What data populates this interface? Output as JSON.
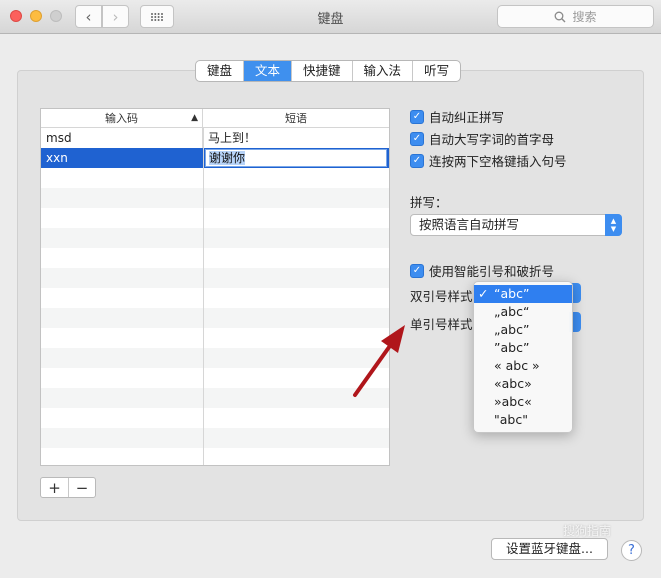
{
  "window": {
    "title": "键盘"
  },
  "search": {
    "placeholder": "搜索"
  },
  "tabs": [
    {
      "label": "键盘",
      "active": false
    },
    {
      "label": "文本",
      "active": true
    },
    {
      "label": "快捷键",
      "active": false
    },
    {
      "label": "输入法",
      "active": false
    },
    {
      "label": "听写",
      "active": false
    }
  ],
  "table": {
    "col_input": "输入码",
    "col_phrase": "短语",
    "rows": [
      {
        "input": "msd",
        "phrase": "马上到！"
      },
      {
        "input": "xxn",
        "phrase": "谢谢你",
        "selected": true
      }
    ]
  },
  "buttons": {
    "add": "+",
    "remove": "−",
    "bluetooth": "设置蓝牙键盘...",
    "help": "?"
  },
  "options": {
    "autocorrect": "自动纠正拼写",
    "capitalize": "自动大写字词的首字母",
    "double_space_period": "连按两下空格键插入句号",
    "spelling_label": "拼写：",
    "spelling_value": "按照语言自动拼写",
    "smart_quotes": "使用智能引号和破折号",
    "double_quote_label": "双引号样式",
    "single_quote_label": "单引号样式"
  },
  "quote_menu": {
    "selected_index": 0,
    "items": [
      "“abc”",
      "„abc“",
      "„abc”",
      "”abc”",
      "« abc »",
      "«abc»",
      "»abc«",
      "\"abc\""
    ]
  },
  "watermark": "搜狗指南",
  "colors": {
    "accent": "#3d8df0",
    "selection": "#1f62d1",
    "arrow": "#b0161b"
  },
  "icons": {
    "search": "search-icon",
    "grid": "grid-icon",
    "check": "checkmark-icon"
  }
}
